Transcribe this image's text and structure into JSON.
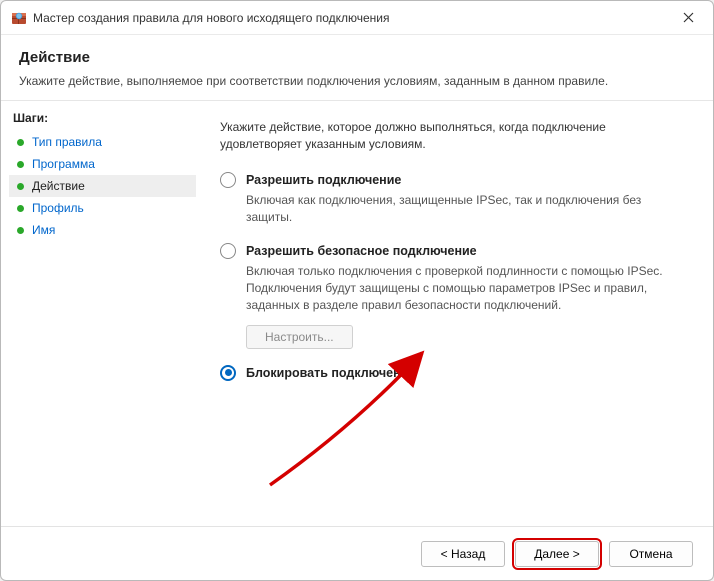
{
  "window": {
    "title": "Мастер создания правила для нового исходящего подключения"
  },
  "header": {
    "title": "Действие",
    "description": "Укажите действие, выполняемое при соответствии подключения условиям, заданным в данном правиле."
  },
  "sidebar": {
    "title": "Шаги:",
    "steps": {
      "rule_type": "Тип правила",
      "program": "Программа",
      "action": "Действие",
      "profile": "Профиль",
      "name": "Имя"
    }
  },
  "main": {
    "intro": "Укажите действие, которое должно выполняться, когда подключение удовлетворяет указанным условиям.",
    "options": {
      "allow": {
        "title": "Разрешить подключение",
        "desc": "Включая как подключения, защищенные IPSec, так и подключения без защиты."
      },
      "allow_secure": {
        "title": "Разрешить безопасное подключение",
        "desc": "Включая только подключения с проверкой подлинности с помощью IPSec. Подключения будут защищены с помощью параметров IPSec и правил, заданных в разделе правил безопасности подключений.",
        "configure": "Настроить..."
      },
      "block": {
        "title": "Блокировать подключение"
      }
    }
  },
  "footer": {
    "back": "< Назад",
    "next": "Далее >",
    "cancel": "Отмена"
  }
}
